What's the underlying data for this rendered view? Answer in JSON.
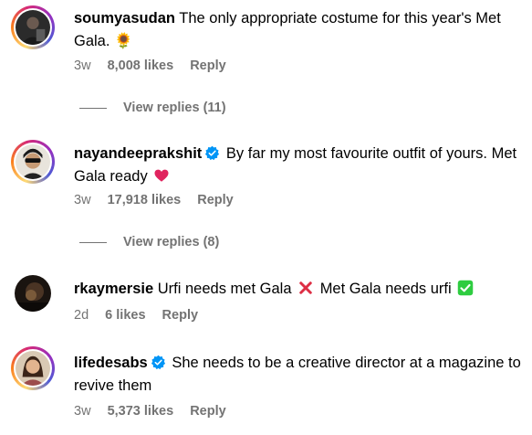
{
  "comments": [
    {
      "username": "soumyasudan",
      "verified": false,
      "text": "The only appropriate costume for this year's Met Gala. 🌻",
      "time": "3w",
      "likes": "8,008 likes",
      "reply": "Reply",
      "view_replies": "View replies (11)"
    },
    {
      "username": "nayandeeprakshit",
      "verified": true,
      "text": "By far my most favourite outfit of yours. Met Gala ready",
      "emoji": "heart",
      "time": "3w",
      "likes": "17,918 likes",
      "reply": "Reply",
      "view_replies": "View replies (8)"
    },
    {
      "username": "rkaymersie",
      "verified": false,
      "text_part1": "Urfi needs met Gala",
      "text_part2": "Met Gala needs urfi",
      "emoji1": "cross-mark",
      "emoji2": "check-mark",
      "time": "2d",
      "likes": "6 likes",
      "reply": "Reply"
    },
    {
      "username": "lifedesabs",
      "verified": true,
      "text": "She needs to be a creative director at a magazine to revive them",
      "time": "3w",
      "likes": "5,373 likes",
      "reply": "Reply"
    }
  ],
  "colors": {
    "verified": "#0095f6",
    "muted": "#737373",
    "heart": "#e0245e",
    "cross": "#dd2e44",
    "check": "#2ecc40"
  }
}
